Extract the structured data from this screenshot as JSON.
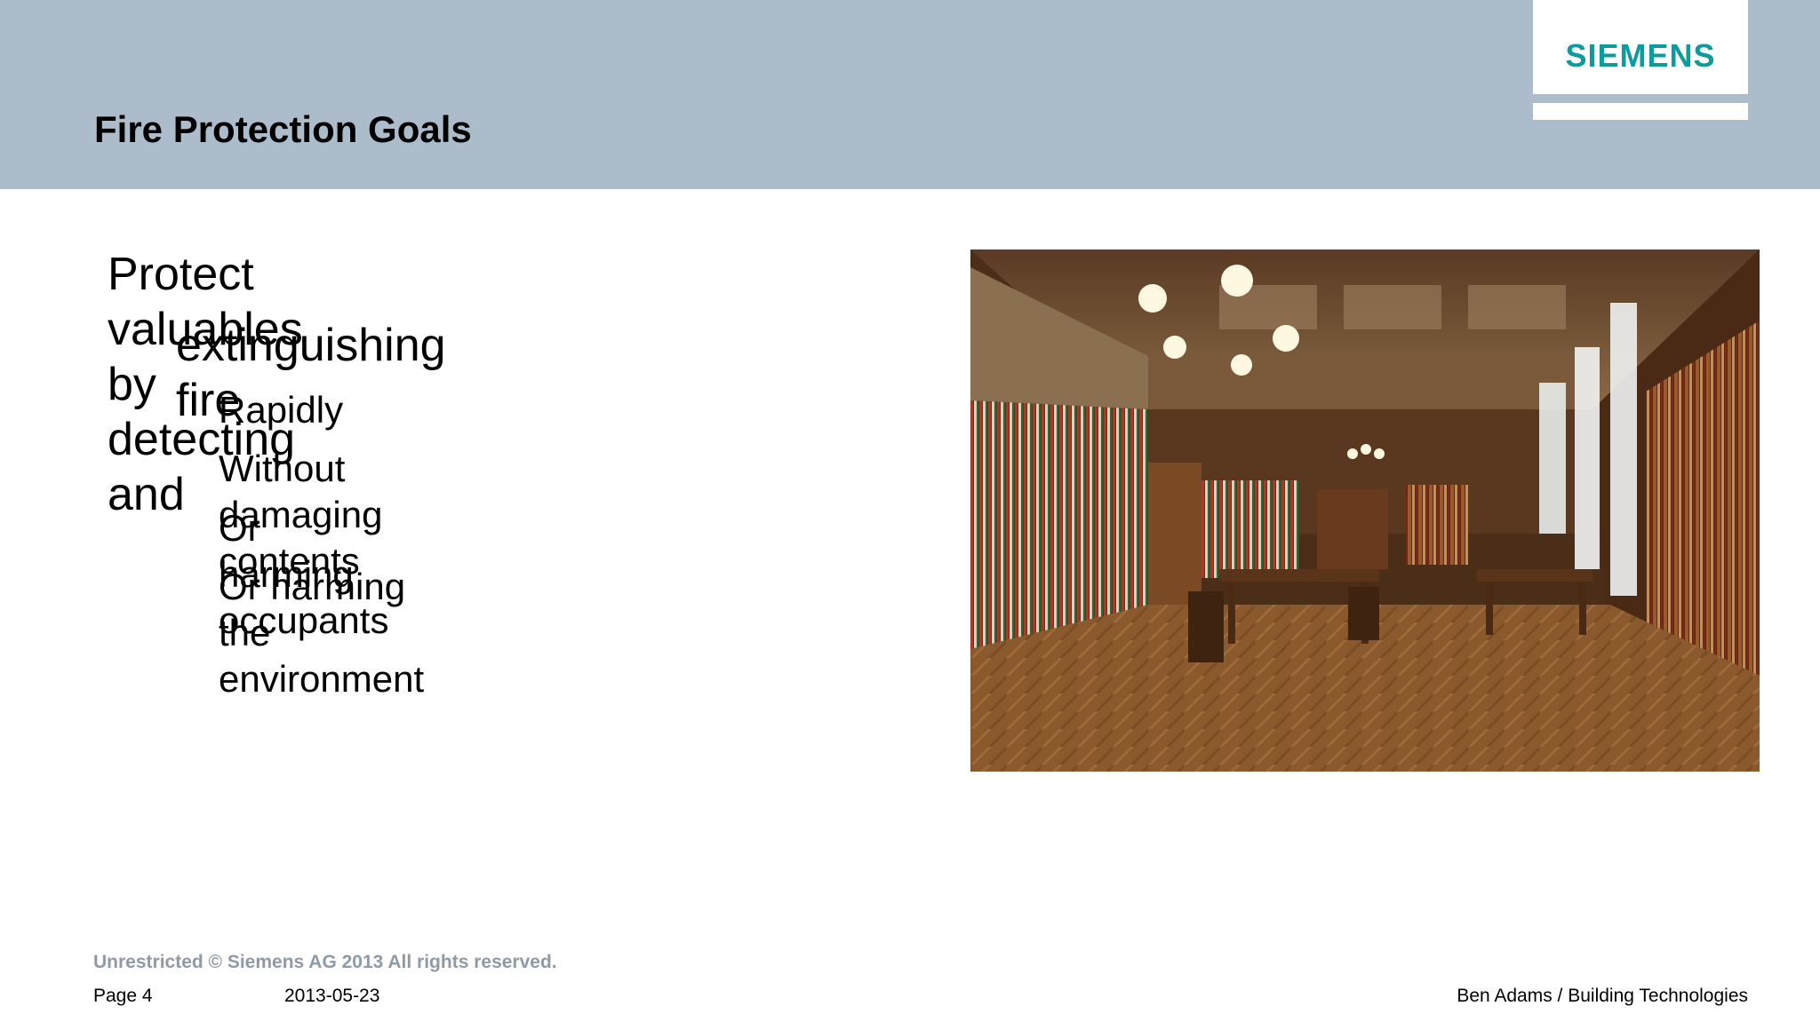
{
  "slide": {
    "title": "Fire Protection Goals",
    "logo": "SIEMENS",
    "bullet_main_line1": "Protect valuables by detecting and",
    "bullet_main_line2": "extinguishing fire",
    "sub_bullets": [
      "Rapidly",
      "Without damaging contents",
      "Or harming occupants",
      "Or harming the environment"
    ]
  },
  "footer": {
    "copyright": "Unrestricted © Siemens AG 2013 All rights reserved.",
    "page": "Page 4",
    "date": "2013-05-23",
    "author": "Ben Adams / Building Technologies"
  },
  "colors": {
    "header_bg": "#adbcca",
    "logo_teal": "#0f9b9c",
    "footer_gray": "#8e9aa5"
  }
}
